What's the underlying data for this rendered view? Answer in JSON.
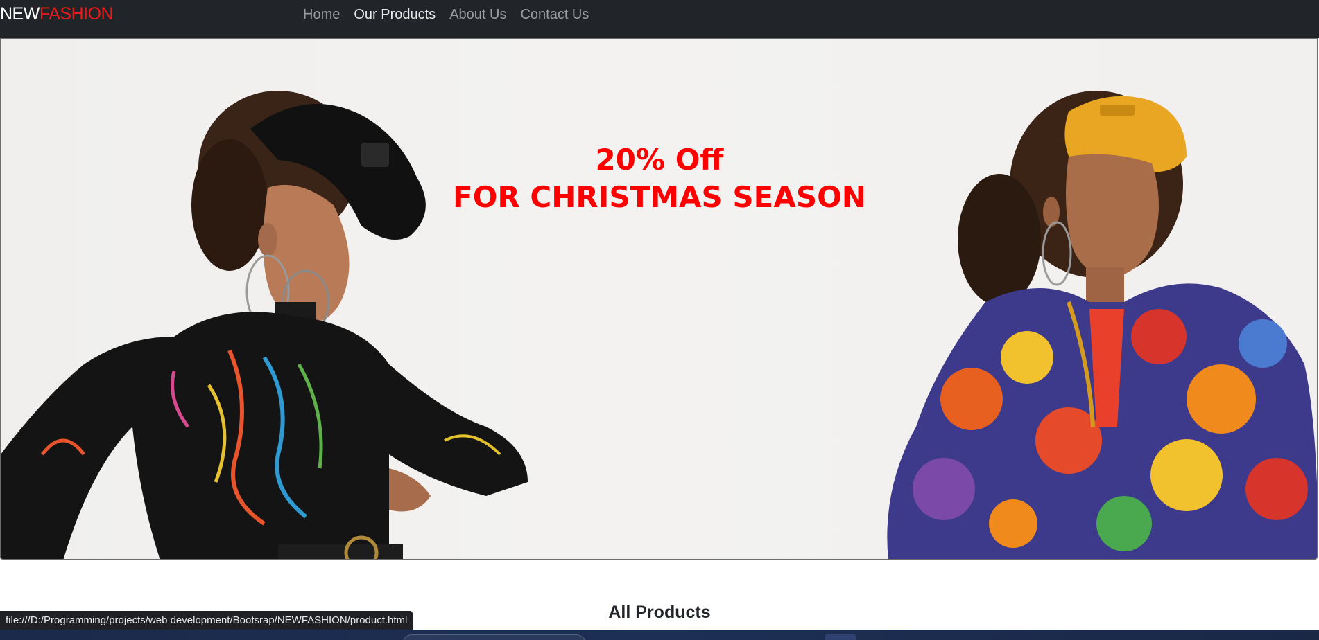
{
  "navbar": {
    "brand_part1": "NEW",
    "brand_part2": "FASHION",
    "links": [
      {
        "label": "Home",
        "active": false
      },
      {
        "label": "Our Products",
        "active": true
      },
      {
        "label": "About Us",
        "active": false
      },
      {
        "label": "Contact Us",
        "active": false
      }
    ]
  },
  "hero": {
    "line1": "20% Off",
    "line2": "FOR CHRISTMAS SEASON",
    "text_color": "#ff0000"
  },
  "section": {
    "title": "All Products"
  },
  "status_bar": {
    "url": "file:///D:/Programming/projects/web development/Bootsrap/NEWFASHION/product.html"
  },
  "colors": {
    "navbar_bg": "#212529",
    "brand_accent": "#e31b1b"
  }
}
